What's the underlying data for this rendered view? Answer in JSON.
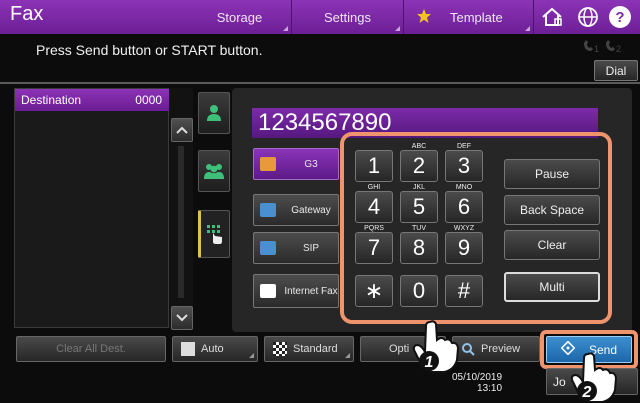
{
  "app_title": "Fax",
  "top_tabs": [
    {
      "label": "Storage"
    },
    {
      "label": "Settings"
    },
    {
      "label": "Template"
    }
  ],
  "message": "Press Send button or START button.",
  "dial_label": "Dial",
  "destination": {
    "label": "Destination",
    "count": "0000"
  },
  "number_value": "1234567890",
  "lines": [
    {
      "label": "G3",
      "active": true
    },
    {
      "label": "Gateway"
    },
    {
      "label": "SIP"
    },
    {
      "label": "Internet Fax"
    }
  ],
  "keypad": [
    {
      "digit": "1",
      "sub": ""
    },
    {
      "digit": "2",
      "sub": "ABC"
    },
    {
      "digit": "3",
      "sub": "DEF"
    },
    {
      "digit": "4",
      "sub": "GHI"
    },
    {
      "digit": "5",
      "sub": "JKL"
    },
    {
      "digit": "6",
      "sub": "MNO"
    },
    {
      "digit": "7",
      "sub": "PQRS"
    },
    {
      "digit": "8",
      "sub": "TUV"
    },
    {
      "digit": "9",
      "sub": "WXYZ"
    },
    {
      "digit": "∗",
      "sub": ""
    },
    {
      "digit": "0",
      "sub": ""
    },
    {
      "digit": "#",
      "sub": ""
    }
  ],
  "functions": [
    "Pause",
    "Back Space",
    "Clear",
    "Multi"
  ],
  "bottom": {
    "clear_all": "Clear All Dest.",
    "auto": "Auto",
    "standard": "Standard",
    "option": "Opti",
    "preview": "Preview",
    "send": "Send",
    "job": "Jo"
  },
  "datetime": {
    "date": "05/10/2019",
    "time": "13:10"
  },
  "callouts": [
    "1",
    "2"
  ],
  "colors": {
    "accent_purple": "#7c2ba8",
    "callout_orange": "#f0946e",
    "send_blue": "#2a7fc4"
  }
}
